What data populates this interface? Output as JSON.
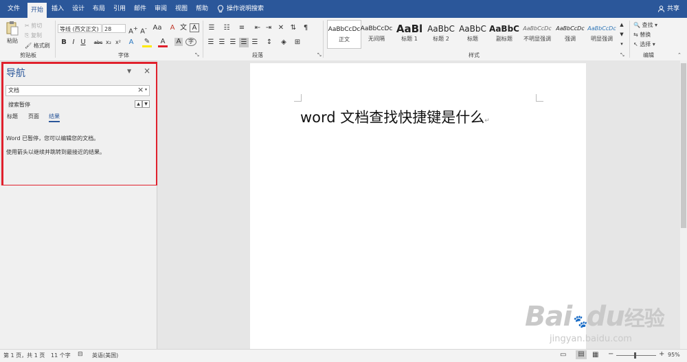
{
  "tabs": [
    "文件",
    "开始",
    "插入",
    "设计",
    "布局",
    "引用",
    "邮件",
    "审阅",
    "视图",
    "帮助"
  ],
  "tell_me": "操作说明搜索",
  "share": "共享",
  "clipboard": {
    "paste": "粘贴",
    "cut": "剪切",
    "copy": "复制",
    "format_painter": "格式刷",
    "label": "剪贴板"
  },
  "font": {
    "name": "等线 (西文正文)",
    "size": "28",
    "label": "字体"
  },
  "paragraph_label": "段落",
  "styles": {
    "label": "样式",
    "items": [
      {
        "sample": "AaBbCcDc",
        "name": "正文"
      },
      {
        "sample": "AaBbCcDc",
        "name": "无间隔"
      },
      {
        "sample": "AaBl",
        "name": "标题 1"
      },
      {
        "sample": "AaBbC",
        "name": "标题 2"
      },
      {
        "sample": "AaBbC",
        "name": "标题"
      },
      {
        "sample": "AaBbC",
        "name": "副标题"
      },
      {
        "sample": "AaBbCcDc",
        "name": "不明显强调"
      },
      {
        "sample": "AaBbCcDc",
        "name": "强调"
      },
      {
        "sample": "AaBbCcDc",
        "name": "明显强调"
      }
    ]
  },
  "editing": {
    "find": "查找",
    "replace": "替换",
    "select": "选择",
    "label": "编辑"
  },
  "nav": {
    "title": "导航",
    "search_value": "文档",
    "status": "搜索暂停",
    "tabs": [
      "标题",
      "页面",
      "结果"
    ],
    "msg1": "Word 已暂停，您可以编辑您的文档。",
    "msg2": "使用箭头以继续并跳转到最接近的结果。"
  },
  "document": {
    "text": "word 文档查找快捷键是什么"
  },
  "status": {
    "page": "第 1 页，共 1 页",
    "words": "11 个字",
    "lang": "英语(美国)",
    "zoom": "95%"
  },
  "watermark": {
    "brand": "Bai",
    "brand2": "du",
    "cn": "经验",
    "url": "jingyan.baidu.com"
  },
  "colors": {
    "brand": "#2b579a",
    "highlight": "#e0202c"
  }
}
